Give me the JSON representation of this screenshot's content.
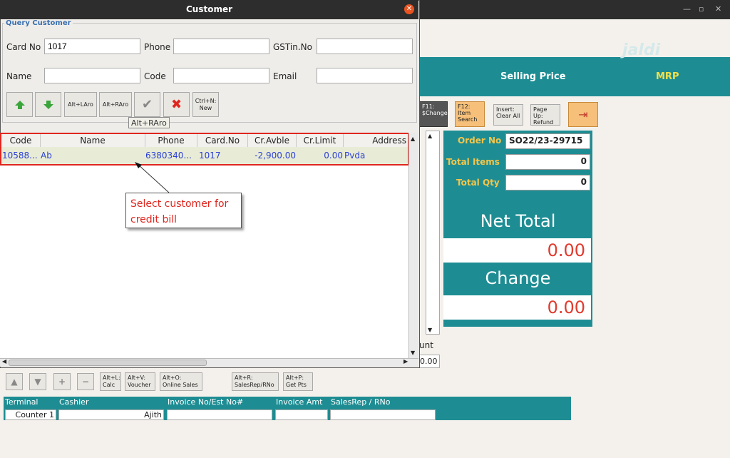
{
  "main": {
    "brand": "jaldi",
    "header": {
      "selling_price": "Selling Price",
      "mrp": "MRP"
    },
    "toolbar": [
      {
        "label": "F11: $Change"
      },
      {
        "label": "F12: Item Search"
      },
      {
        "label": "Insert: Clear All"
      },
      {
        "label": "Page Up: Refund"
      }
    ],
    "summary": {
      "order_no_label": "Order No",
      "order_no": "SO22/23-29715",
      "total_items_label": "Total Items",
      "total_items": "0",
      "total_qty_label": "Total Qty",
      "total_qty": "0",
      "net_total_label": "Net Total",
      "net_total": "0.00",
      "change_label": "Change",
      "change": "0.00"
    },
    "partial_label": "unt",
    "partial_value": "0.00",
    "bottom_buttons": {
      "calc": "Alt+L: Calc",
      "voucher": "Alt+V: Voucher",
      "online_sales": "Alt+O: Online Sales",
      "salesrep": "Alt+R: SalesRep/RNo",
      "get_pts": "Alt+P: Get Pts"
    },
    "footer": {
      "headers": [
        "Terminal",
        "Cashier",
        "Invoice No/Est No#",
        "Invoice Amt",
        "SalesRep / RNo"
      ],
      "terminal": "Counter 1",
      "cashier": "Ajith"
    }
  },
  "dialog": {
    "title": "Customer",
    "query_legend": "Query Customer",
    "fields": {
      "card_no_label": "Card No",
      "card_no_value": "1017",
      "phone_label": "Phone",
      "gstin_label": "GSTin.No",
      "name_label": "Name",
      "code_label": "Code",
      "email_label": "Email"
    },
    "buttons": {
      "alt_larrow": "Alt+LAro",
      "alt_rarrow": "Alt+RAro",
      "new": "Ctrl+N: New"
    },
    "tooltip": "Alt+RAro",
    "table": {
      "columns": [
        "Code",
        "Name",
        "Phone",
        "Card.No",
        "Cr.Avble",
        "Cr.Limit",
        "Address"
      ],
      "rows": [
        {
          "code": "10588...",
          "name": "Ab",
          "phone": "6380340...",
          "card_no": "1017",
          "cr_avble": "-2,900.00",
          "cr_limit": "0.00",
          "address": "Pvda"
        }
      ]
    },
    "callout": "Select customer for credit bill"
  },
  "colors": {
    "teal": "#1e8d93",
    "accent_red": "#e0261f",
    "value_red": "#e23b2e",
    "gold": "#f4c54a"
  }
}
